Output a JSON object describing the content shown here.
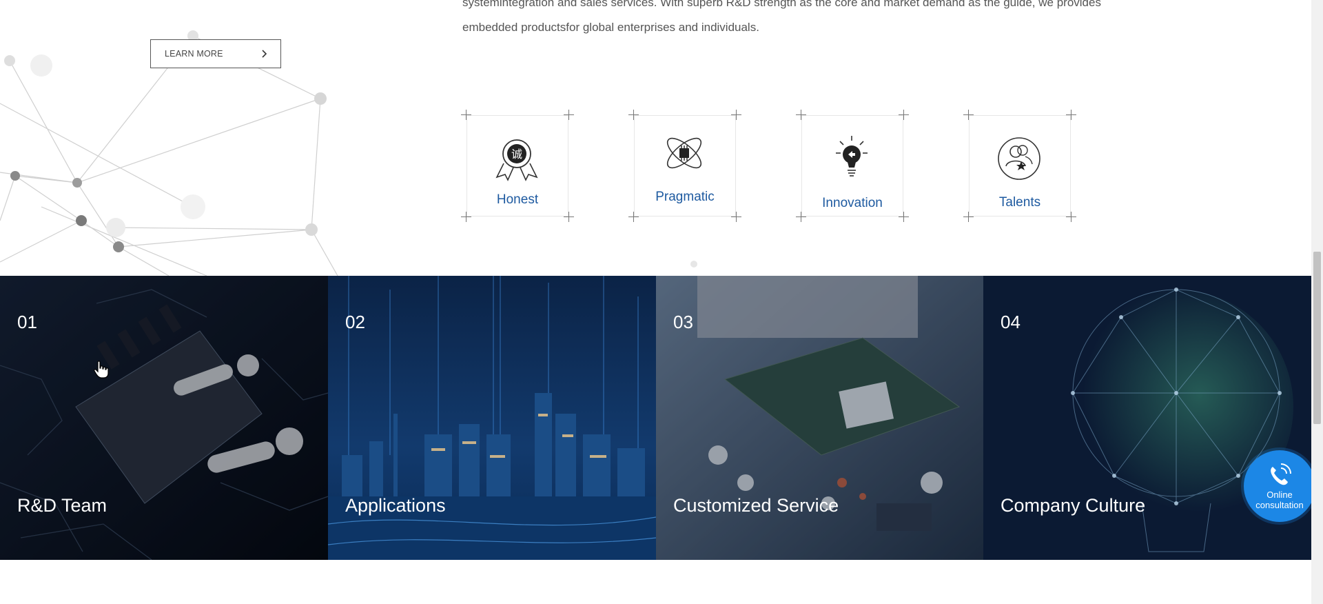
{
  "intro": {
    "line1": "systemintegration and sales services. With superb R&D strength as the core and market demand as the guide, we provides",
    "line2": "embedded productsfor global enterprises and individuals."
  },
  "learn_more": {
    "label": "LEARN MORE",
    "icon": "chevron-right-icon"
  },
  "values": [
    {
      "label": "Honest",
      "icon": "medal-icon",
      "glyph": "诚"
    },
    {
      "label": "Pragmatic",
      "icon": "atom-chip-icon"
    },
    {
      "label": "Innovation",
      "icon": "lightbulb-icon"
    },
    {
      "label": "Talents",
      "icon": "people-star-icon"
    }
  ],
  "panels": [
    {
      "num": "01",
      "title": "R&D Team",
      "image": "robot-hand-chip-image"
    },
    {
      "num": "02",
      "title": "Applications",
      "image": "city-skyline-image"
    },
    {
      "num": "03",
      "title": "Customized Service",
      "image": "circuit-board-image"
    },
    {
      "num": "04",
      "title": "Company Culture",
      "image": "network-lightbulb-image"
    }
  ],
  "consult": {
    "line1": "Online",
    "line2": "consultation",
    "icon": "phone-icon"
  },
  "colors": {
    "accent_blue": "#1e5aa0",
    "consult_blue": "#1c87e6",
    "panel_dark": "#0b1a33"
  }
}
